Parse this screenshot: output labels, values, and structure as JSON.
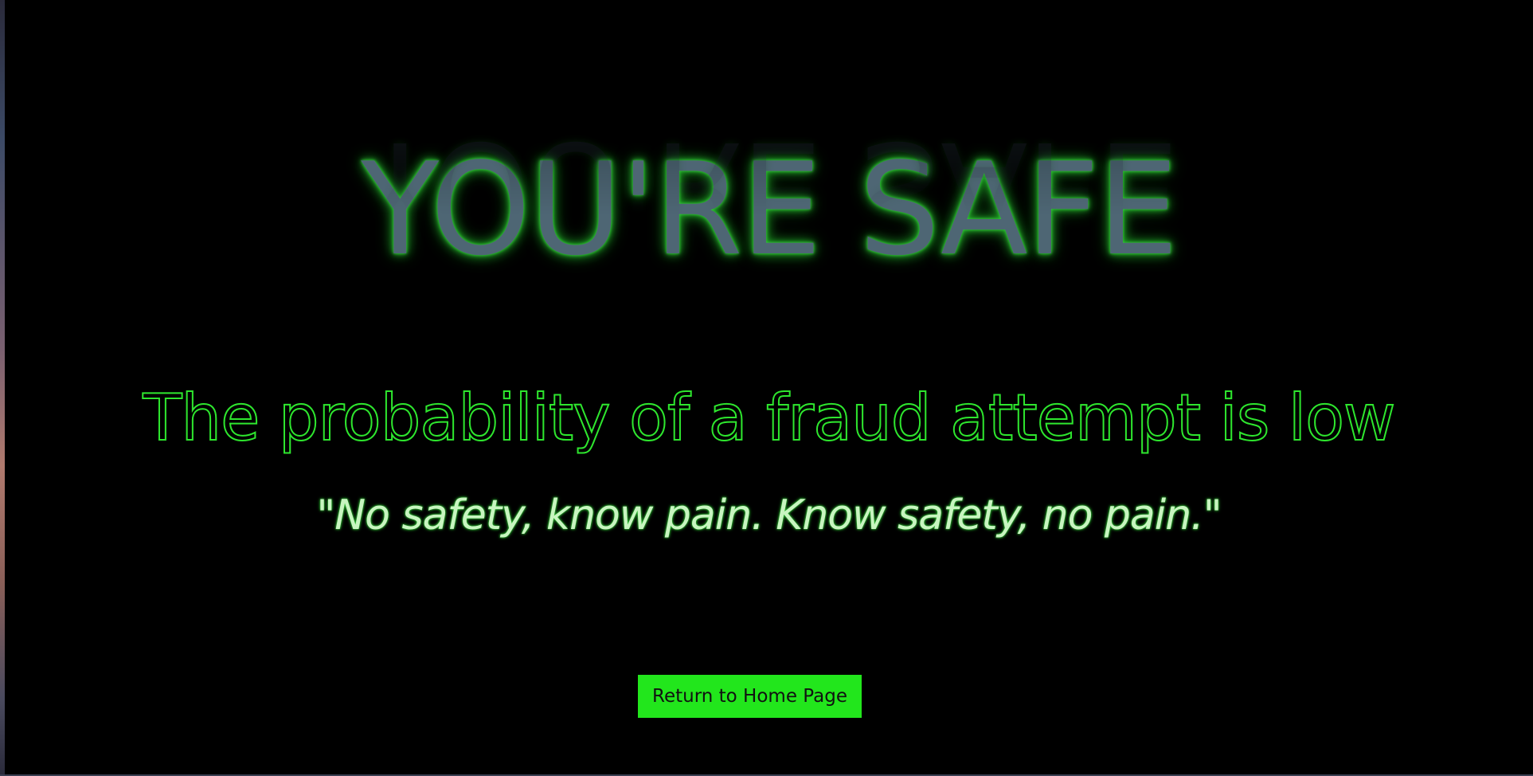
{
  "hero": {
    "title": "YOU'RE SAFE"
  },
  "result": {
    "message": "The probability of a fraud attempt is low"
  },
  "quote": {
    "text": "\"No safety, know pain. Know safety, no pain.\""
  },
  "actions": {
    "home_button_label": "Return to Home Page"
  },
  "colors": {
    "background": "#000000",
    "accent_green": "#22e61c",
    "title_fill": "#4e6674",
    "quote_fill": "#c8f5c0"
  }
}
